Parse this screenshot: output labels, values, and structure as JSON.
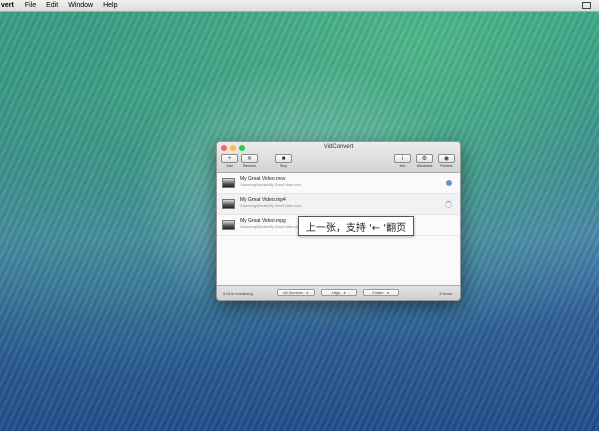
{
  "menubar": {
    "app_name": "vert",
    "items": [
      "File",
      "Edit",
      "Window",
      "Help"
    ]
  },
  "window": {
    "title": "VidConvert",
    "toolbar": {
      "add": {
        "icon": "+",
        "label": "Add"
      },
      "remove": {
        "icon": "✕",
        "label": "Remove"
      },
      "stop": {
        "icon": "■",
        "label": "Stop"
      },
      "info": {
        "icon": "i",
        "label": "Info"
      },
      "advanced": {
        "icon": "⚙",
        "label": "Advanced"
      },
      "preview": {
        "icon": "◉",
        "label": "Preview"
      }
    },
    "files": [
      {
        "name": "My Great Video.mov",
        "path": "/Users/reg/Movies/My Great Video.mov",
        "status": "done"
      },
      {
        "name": "My Great Video.mp4",
        "path": "/Users/reg/Movies/My Great Video.mp4",
        "status": "converting"
      },
      {
        "name": "My Great Video.mpg",
        "path": "/Users/reg/Movies/My Great Video.mpg",
        "status": "queued"
      }
    ],
    "bottom": {
      "remaining": "0:01m remaining",
      "device": "All Devices",
      "quality": "High",
      "destination": "Folder",
      "count": "3 items"
    }
  },
  "overlay_hint": "上一张，支持 '← '翻页",
  "colors": {
    "status_blue": "#6b8ed8",
    "close": "#fc605b",
    "minimize": "#fdbc40",
    "maximize": "#34c84a"
  }
}
